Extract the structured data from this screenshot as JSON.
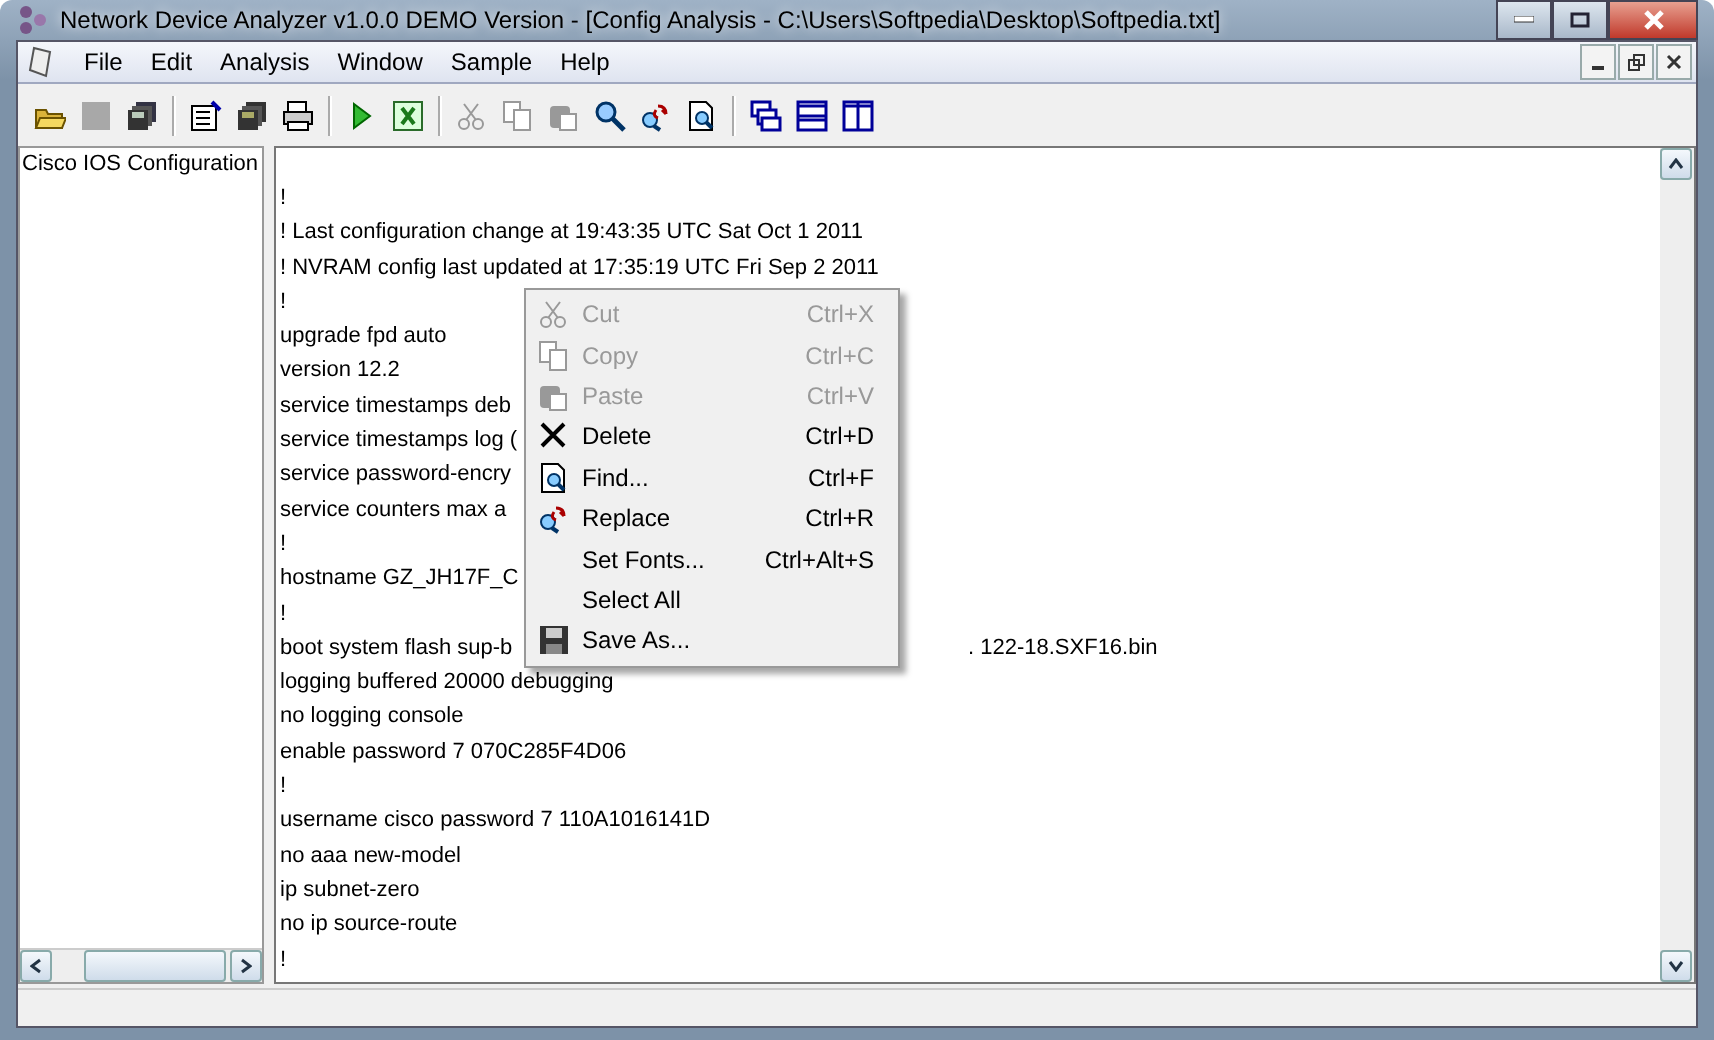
{
  "window": {
    "title": "Network Device Analyzer v1.0.0 DEMO Version - [Config Analysis - C:\\Users\\Softpedia\\Desktop\\Softpedia.txt]"
  },
  "menu_bar": [
    "File",
    "Edit",
    "Analysis",
    "Window",
    "Sample",
    "Help"
  ],
  "sidebar": {
    "items": [
      {
        "label": "Cisco IOS Configuration",
        "selected": false
      }
    ]
  },
  "editor": {
    "lines": [
      {
        "text": "!"
      },
      {
        "text": "! Last configuration change at 19:43:35 UTC Sat Oct 1 2011"
      },
      {
        "text": "! NVRAM config last updated at 17:35:19 UTC Fri Sep 2 2011"
      },
      {
        "text": "!"
      },
      {
        "text": "upgrade fpd auto"
      },
      {
        "text": "version 12.2"
      },
      {
        "text": "service timestamps deb"
      },
      {
        "text": "service timestamps log ("
      },
      {
        "text": "service password-encry"
      },
      {
        "text": "service counters max a"
      },
      {
        "text": "!"
      },
      {
        "text": "hostname GZ_JH17F_C"
      },
      {
        "text": "!"
      },
      {
        "text": "boot system flash sup-b",
        "tail": ". 122-18.SXF16.bin"
      },
      {
        "text": "logging buffered 20000 debugging"
      },
      {
        "text": "no logging console"
      },
      {
        "text": "enable password 7 070C285F4D06"
      },
      {
        "text": "!"
      },
      {
        "text": "username cisco password 7 110A1016141D"
      },
      {
        "text": "no aaa new-model"
      },
      {
        "text": "ip subnet-zero"
      },
      {
        "text": "no ip source-route"
      },
      {
        "text": "!"
      }
    ]
  },
  "context_menu": [
    {
      "kind": "cut",
      "label": "Cut",
      "shortcut": "Ctrl+X",
      "disabled": true
    },
    {
      "kind": "copy",
      "label": "Copy",
      "shortcut": "Ctrl+C",
      "disabled": true
    },
    {
      "kind": "paste",
      "label": "Paste",
      "shortcut": "Ctrl+V",
      "disabled": true
    },
    {
      "kind": "delete",
      "label": "Delete",
      "shortcut": "Ctrl+D",
      "disabled": false
    },
    {
      "kind": "find",
      "label": "Find...",
      "shortcut": "Ctrl+F",
      "disabled": false
    },
    {
      "kind": "replace",
      "label": "Replace",
      "shortcut": "Ctrl+R",
      "disabled": false
    },
    {
      "kind": "none",
      "label": "Set Fonts...",
      "shortcut": "Ctrl+Alt+S",
      "disabled": false
    },
    {
      "kind": "none",
      "label": "Select All",
      "disabled": false
    },
    {
      "kind": "save",
      "label": "Save As...",
      "disabled": false
    }
  ]
}
